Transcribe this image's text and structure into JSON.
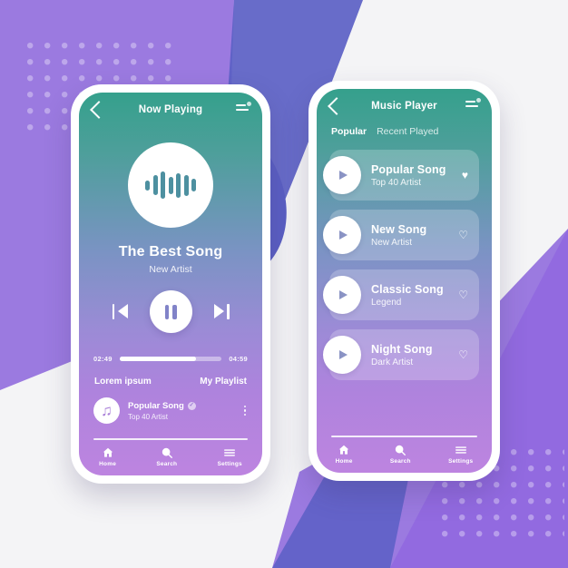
{
  "palette": {
    "bg_light": "#f4f4f6",
    "purple": "#9b7ae0",
    "purple_dark": "#5b5fc4",
    "purple_bright": "#8b5ce0",
    "teal": "#35a08c",
    "accent_violet": "#8183c8"
  },
  "phone1": {
    "topbar": {
      "title": "Now Playing",
      "back_icon": "chevron-left-icon",
      "menu_icon": "menu-icon"
    },
    "album_art": {
      "icon": "waveform-icon",
      "bars": [
        11,
        22,
        30,
        19,
        27,
        23,
        14
      ]
    },
    "song": {
      "title": "The Best Song",
      "artist": "New Artist"
    },
    "controls": {
      "previous": "skip-previous-icon",
      "play_pause": "pause-icon",
      "next": "skip-next-icon"
    },
    "progress": {
      "current_time": "02:49",
      "total_time": "04:59",
      "percent": 75
    },
    "links": {
      "left": "Lorem ipsum",
      "right": "My Playlist"
    },
    "mini_player": {
      "avatar_icon": "music-note-icon",
      "title": "Popular Song",
      "artist": "Top 40 Artist",
      "verified": "✓",
      "menu_icon": "kebab-menu-icon"
    },
    "nav": [
      {
        "label": "Home",
        "icon": "home-icon"
      },
      {
        "label": "Search",
        "icon": "search-icon"
      },
      {
        "label": "Settings",
        "icon": "settings-icon"
      }
    ]
  },
  "phone2": {
    "topbar": {
      "title": "Music Player",
      "back_icon": "chevron-left-icon",
      "menu_icon": "menu-icon"
    },
    "tabs": [
      {
        "label": "Popular",
        "active": true
      },
      {
        "label": "Recent Played",
        "active": false
      }
    ],
    "songs": [
      {
        "title": "Popular Song",
        "artist": "Top 40 Artist",
        "liked": true,
        "heart": "♥",
        "play_icon": "play-icon"
      },
      {
        "title": "New Song",
        "artist": "New Artist",
        "liked": false,
        "heart": "♡",
        "play_icon": "play-icon"
      },
      {
        "title": "Classic Song",
        "artist": "Legend",
        "liked": false,
        "heart": "♡",
        "play_icon": "play-icon"
      },
      {
        "title": "Night Song",
        "artist": "Dark Artist",
        "liked": false,
        "heart": "♡",
        "play_icon": "play-icon"
      }
    ],
    "nav": [
      {
        "label": "Home",
        "icon": "home-icon"
      },
      {
        "label": "Search",
        "icon": "search-icon"
      },
      {
        "label": "Settings",
        "icon": "settings-icon"
      }
    ]
  }
}
